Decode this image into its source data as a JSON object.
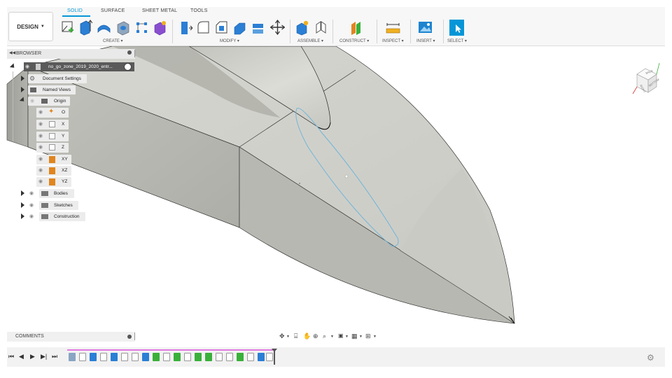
{
  "workspace": {
    "label": "DESIGN"
  },
  "tabs": [
    {
      "label": "SOLID",
      "active": true
    },
    {
      "label": "SURFACE",
      "active": false
    },
    {
      "label": "SHEET METAL",
      "active": false
    },
    {
      "label": "TOOLS",
      "active": false
    }
  ],
  "groups": [
    {
      "label": "CREATE ▾"
    },
    {
      "label": "MODIFY ▾"
    },
    {
      "label": "ASSEMBLE ▾"
    },
    {
      "label": "CONSTRUCT ▾"
    },
    {
      "label": "INSPECT ▾"
    },
    {
      "label": "INSERT ▾"
    },
    {
      "label": "SELECT ▾"
    }
  ],
  "browser": {
    "title": "BROWSER",
    "root": "no_go_zone_2019_2020_entr...",
    "items": [
      {
        "label": "Document Settings",
        "icon": "gear-icon"
      },
      {
        "label": "Named Views",
        "icon": "folder-icon"
      },
      {
        "label": "Origin",
        "icon": "folder-icon"
      },
      {
        "label": "O",
        "icon": "origin-point-icon"
      },
      {
        "label": "X",
        "icon": "axis-icon"
      },
      {
        "label": "Y",
        "icon": "axis-icon"
      },
      {
        "label": "Z",
        "icon": "axis-icon"
      },
      {
        "label": "XY",
        "icon": "plane-icon"
      },
      {
        "label": "XZ",
        "icon": "plane-icon"
      },
      {
        "label": "YZ",
        "icon": "plane-icon"
      },
      {
        "label": "Bodies",
        "icon": "bodies-folder-icon"
      },
      {
        "label": "Sketches",
        "icon": "sketches-folder-icon"
      },
      {
        "label": "Construction",
        "icon": "folder-icon"
      }
    ]
  },
  "comments": {
    "title": "COMMENTS"
  },
  "viewcube": {
    "faces": [
      "BACK",
      "RIGHT",
      "BOTTOM"
    ]
  },
  "colors": {
    "accent": "#0696d7",
    "model_fill": "#cfcfc9",
    "sketch_line": "#6fb6d8",
    "timeline_track": "#e27ae2"
  }
}
